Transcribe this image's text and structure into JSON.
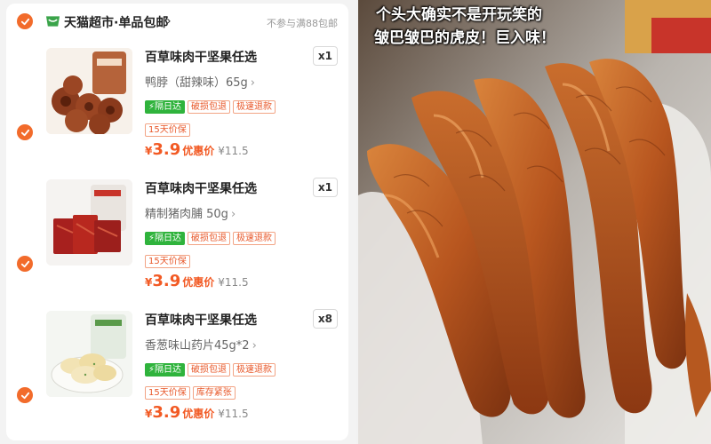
{
  "cart": {
    "store_name": "天猫超市·单品包邮",
    "store_chevron": "›",
    "store_note": "不参与满88包邮",
    "items": [
      {
        "title": "百草味肉干坚果任选",
        "variant": "鸭脖（甜辣味）65g",
        "quantity": "x1",
        "tags": [
          "⚡隔日达",
          "破损包退",
          "极速退款",
          "15天价保"
        ],
        "price_symbol": "¥",
        "price": "3.9",
        "price_label": "优惠价",
        "original_price": "¥11.5",
        "thumb_icon": "braised-duck-neck-icon"
      },
      {
        "title": "百草味肉干坚果任选",
        "variant": "精制猪肉脯 50g",
        "quantity": "x1",
        "tags": [
          "⚡隔日达",
          "破损包退",
          "极速退款",
          "15天价保"
        ],
        "price_symbol": "¥",
        "price": "3.9",
        "price_label": "优惠价",
        "original_price": "¥11.5",
        "thumb_icon": "pork-jerky-icon"
      },
      {
        "title": "百草味肉干坚果任选",
        "variant": "香葱味山药片45g*2",
        "quantity": "x8",
        "tags": [
          "⚡隔日达",
          "破损包退",
          "极速退款",
          "15天价保",
          "库存紧张"
        ],
        "price_symbol": "¥",
        "price": "3.9",
        "price_label": "优惠价",
        "original_price": "¥11.5",
        "thumb_icon": "yam-chips-icon"
      }
    ]
  },
  "photo": {
    "caption_line1": "个头大确实不是开玩笑的",
    "caption_line2": "皱巴皱巴的虎皮！巨入味！",
    "image_icon": "tiger-skin-chicken-feet-photo"
  },
  "colors": {
    "accent": "#f26b2b",
    "price": "#f25a24",
    "green_tag": "#2fb33c"
  }
}
